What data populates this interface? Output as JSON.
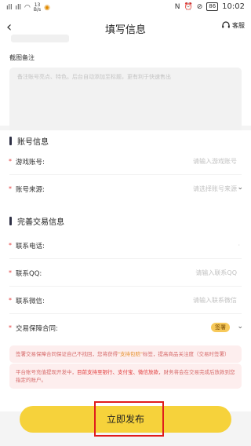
{
  "status_bar": {
    "signal": "ıll",
    "net_speed_top": "13",
    "net_speed_bottom": "B/s",
    "battery": "86",
    "time": "10:02"
  },
  "nav": {
    "back_glyph": "‹",
    "title": "填写信息",
    "service_label": "客服",
    "service_icon": "headset-icon"
  },
  "remark": {
    "label": "截图备注",
    "placeholder": "备注账号亮点、特色。后台自动添加至标题，更有利于快速售出"
  },
  "account_section": {
    "title": "账号信息",
    "fields": [
      {
        "required_mark": "*",
        "label": "游戏账号:",
        "placeholder": "请输入游戏账号"
      },
      {
        "required_mark": "*",
        "label": "账号来源:",
        "placeholder": "请选择账号来源"
      }
    ]
  },
  "trade_section": {
    "title": "完善交易信息",
    "fields": [
      {
        "required_mark": "*",
        "label": "联系电话:",
        "placeholder": "·"
      },
      {
        "required_mark": "*",
        "label": "联系QQ:",
        "placeholder": "请输入联系QQ"
      },
      {
        "required_mark": "*",
        "label": "联系微信:",
        "placeholder": "请输入联系微信"
      },
      {
        "required_mark": "*",
        "label": "交易保障合同:",
        "badge": "签署"
      }
    ]
  },
  "notice1": {
    "part1": "签署交易保障合同保证自己不找回，您将获得",
    "highlight": "\"支持包赔\"",
    "part2": "标签，提高商品关注度（交易时签署）"
  },
  "notice2": {
    "part1": "平台账号充值提现开发中，",
    "highlight": "目前支持至银行、支付宝、微信放款",
    "part2": "，财务将会在交易完成后放款到您指定的账户。"
  },
  "submit_label": "立即发布",
  "colors": {
    "accent_yellow": "#f6d23b",
    "required_red": "#e23b3b",
    "highlight_box": "#e01c1c",
    "section_bar": "#2f3146"
  }
}
